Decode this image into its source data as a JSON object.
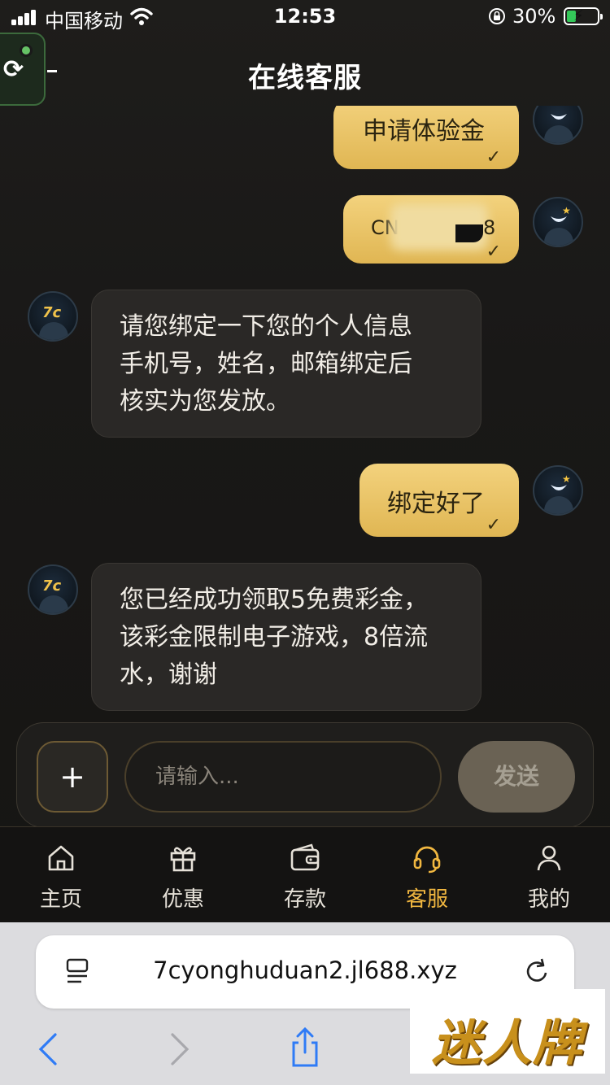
{
  "status_bar": {
    "carrier": "中国移动",
    "time": "12:53",
    "battery": "30%",
    "battery_level": 0.3,
    "icons": [
      "signal-icon",
      "wifi-icon",
      "rotation-lock-icon",
      "battery-charging-icon"
    ]
  },
  "header": {
    "title": "在线客服",
    "float_button_icon": "refresh-icon"
  },
  "messages": [
    {
      "side": "out",
      "text": "申请体验金",
      "read": true
    },
    {
      "side": "out",
      "text": "CN",
      "text_tail": "8",
      "redacted": true,
      "read": true
    },
    {
      "side": "in",
      "lines": [
        "请您绑定一下您的个人信息",
        "手机号，姓名，邮箱绑定后",
        "核实为您发放。"
      ]
    },
    {
      "side": "out",
      "text": "绑定好了",
      "read": true
    },
    {
      "side": "in",
      "lines": [
        "您已经成功领取5免费彩金，",
        "该彩金限制电子游戏，8倍流",
        "水，谢谢"
      ]
    }
  ],
  "agent_avatar_logo": "7c",
  "composer": {
    "plus_label": "+",
    "placeholder": "请输入...",
    "send_label": "发送"
  },
  "tabs": [
    {
      "label": "主页",
      "icon": "home-icon",
      "active": false
    },
    {
      "label": "优惠",
      "icon": "gift-icon",
      "active": false
    },
    {
      "label": "存款",
      "icon": "wallet-icon",
      "active": false
    },
    {
      "label": "客服",
      "icon": "headset-icon",
      "active": true
    },
    {
      "label": "我的",
      "icon": "user-icon",
      "active": false
    }
  ],
  "browser": {
    "url": "7cyonghuduan2.jl688.xyz",
    "icons": [
      "reader-icon",
      "reload-icon",
      "back-icon",
      "forward-icon",
      "share-icon"
    ]
  },
  "watermark": "迷人牌",
  "colors": {
    "accent": "#f1b740",
    "bubble_out": "#e9c465",
    "bubble_in": "#2a2826",
    "send_button": "#6a6254",
    "battery_green": "#34c759"
  }
}
